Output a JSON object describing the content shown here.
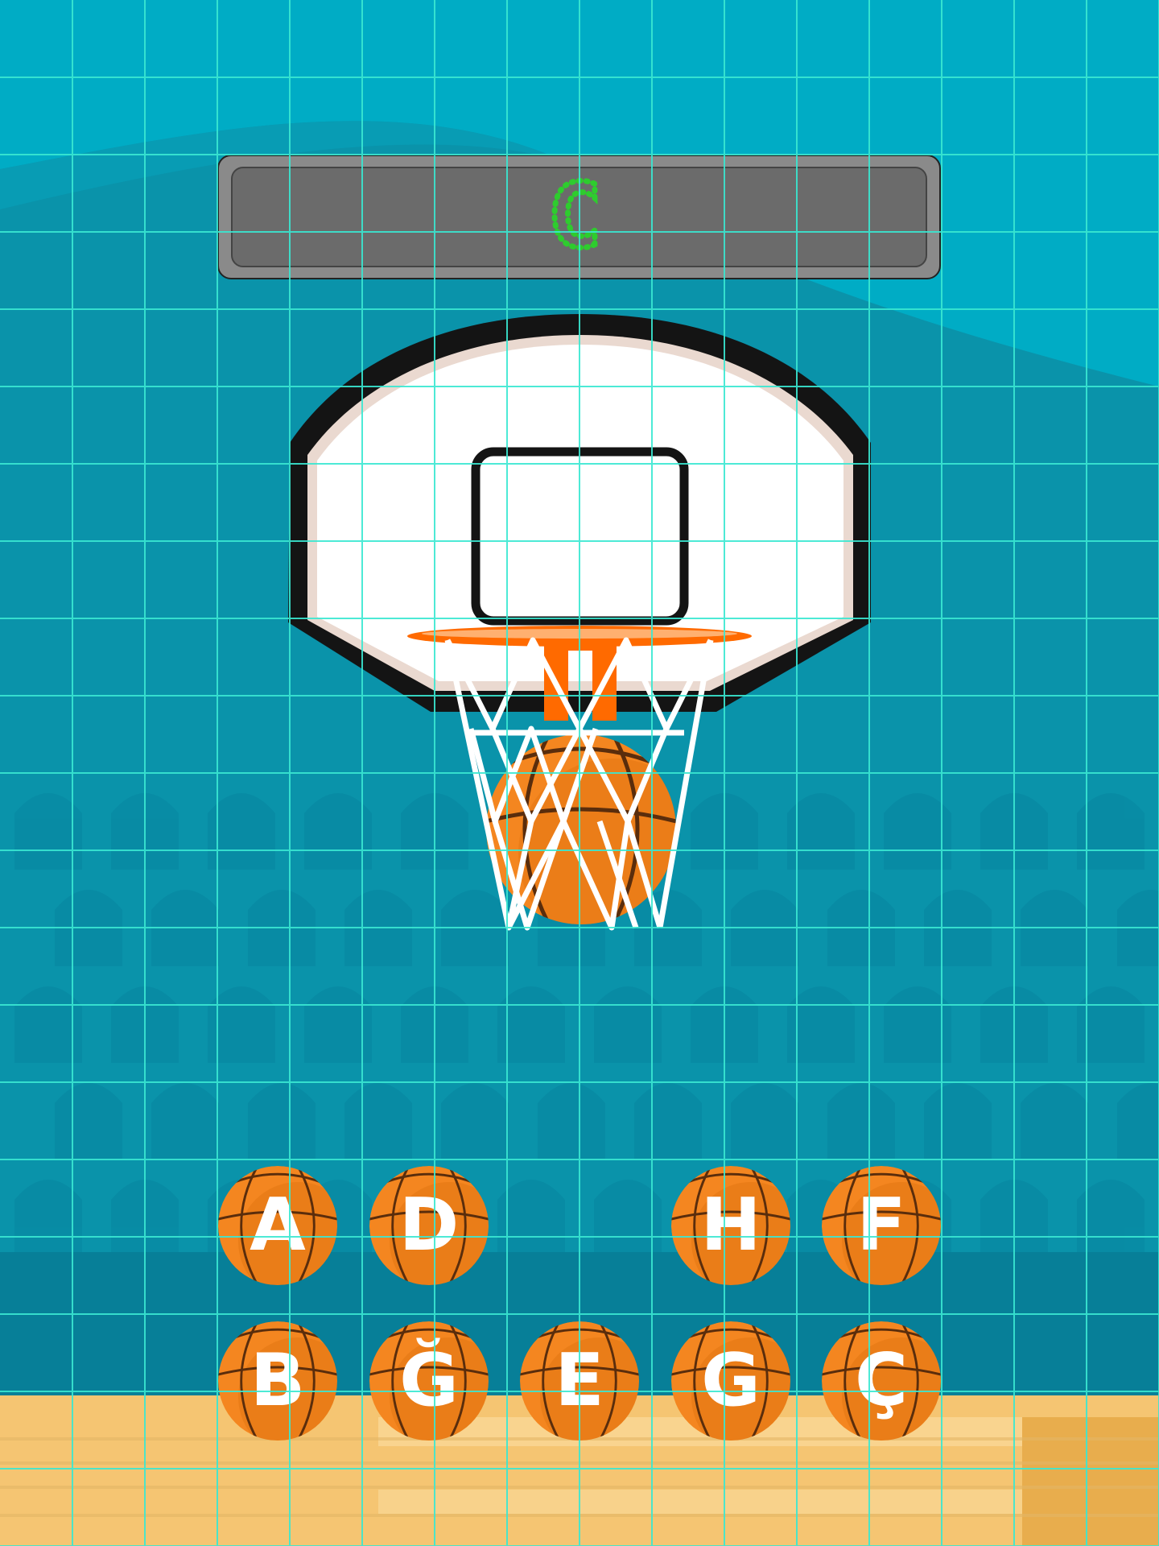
{
  "scoreboard": {
    "letter": "C",
    "letter_color": "#2ecc2e"
  },
  "letter_balls": {
    "row1": [
      "A",
      "D",
      "H",
      "F"
    ],
    "row2": [
      "B",
      "Ğ",
      "E",
      "G",
      "Ç"
    ]
  },
  "colors": {
    "sky": "#00acc5",
    "wall": "#0a93aa",
    "floor": "#f5c572",
    "ball": "#f48620",
    "ball_shade": "#e07410",
    "rim": "#ff6a00",
    "grid": "#3ae8d2",
    "board_frame": "#1c1c1c",
    "scoreboard_bg": "#6b6b6b"
  },
  "icons": [
    "basketball-icon",
    "hoop-icon",
    "net-icon"
  ],
  "grid_overlay": true
}
